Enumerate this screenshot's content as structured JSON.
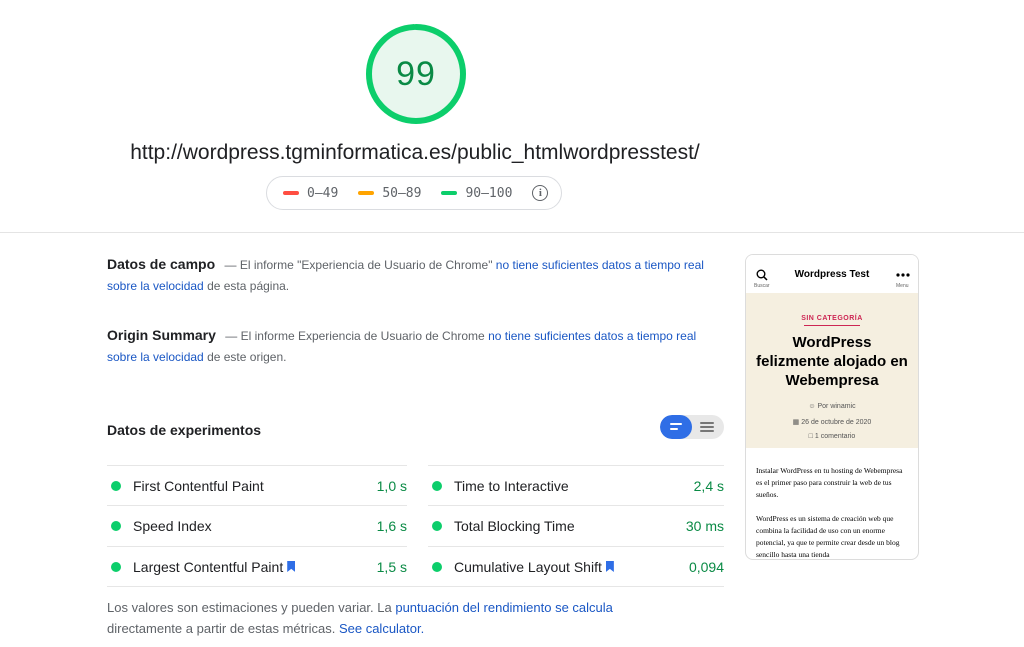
{
  "score": {
    "value": "99",
    "fraction": 0.99,
    "color": "#0cce6b"
  },
  "url": "http://wordpress.tgminformatica.es/public_htmlwordpresstest/",
  "legend": {
    "items": [
      {
        "label": "0–49",
        "color": "#ff4e42"
      },
      {
        "label": "50–89",
        "color": "#ffa400"
      },
      {
        "label": "90–100",
        "color": "#0cce6b"
      }
    ],
    "info_icon": "info-icon"
  },
  "field_data": {
    "title": "Datos de campo",
    "prefix": "— El informe \"Experiencia de Usuario de Chrome\"",
    "link": "no tiene suficientes datos a tiempo real sobre la velocidad",
    "suffix": "de esta página."
  },
  "origin_summary": {
    "title": "Origin Summary",
    "prefix": "— El informe Experiencia de Usuario de Chrome",
    "link": "no tiene suficientes datos a tiempo real sobre la velocidad",
    "suffix": "de este origen."
  },
  "lab_data": {
    "title": "Datos de experimentos",
    "toggle_icons": [
      "list-compact-icon",
      "list-expanded-icon"
    ]
  },
  "metrics": {
    "left": [
      {
        "label": "First Contentful Paint",
        "value": "1,0 s",
        "bookmark": false
      },
      {
        "label": "Speed Index",
        "value": "1,6 s",
        "bookmark": false
      },
      {
        "label": "Largest Contentful Paint",
        "value": "1,5 s",
        "bookmark": true
      }
    ],
    "right": [
      {
        "label": "Time to Interactive",
        "value": "2,4 s",
        "bookmark": false
      },
      {
        "label": "Total Blocking Time",
        "value": "30 ms",
        "bookmark": false
      },
      {
        "label": "Cumulative Layout Shift",
        "value": "0,094",
        "bookmark": true
      }
    ],
    "status_color": "#0cce6b"
  },
  "footnote": {
    "text1": "Los valores son estimaciones y pueden variar. La",
    "link1": "puntuación del rendimiento se calcula",
    "text2": "directamente a partir de estas métricas.",
    "link2": "See calculator."
  },
  "phone": {
    "site_title": "Wordpress Test",
    "search_label": "Buscar",
    "menu_label": "Menu",
    "category": "SIN CATEGORÍA",
    "heading": "WordPress felizmente alojado en Webempresa",
    "author": "Por winamic",
    "date": "26 de octubre de 2020",
    "comments": "1 comentario",
    "para1": "Instalar WordPress en tu hosting de Webempresa es el primer paso para construir la web de tus sueños.",
    "para2": "WordPress es un sistema de creación web que combina la facilidad de uso con un enorme potencial, ya que te permite crear desde un blog sencillo hasta una tienda"
  }
}
